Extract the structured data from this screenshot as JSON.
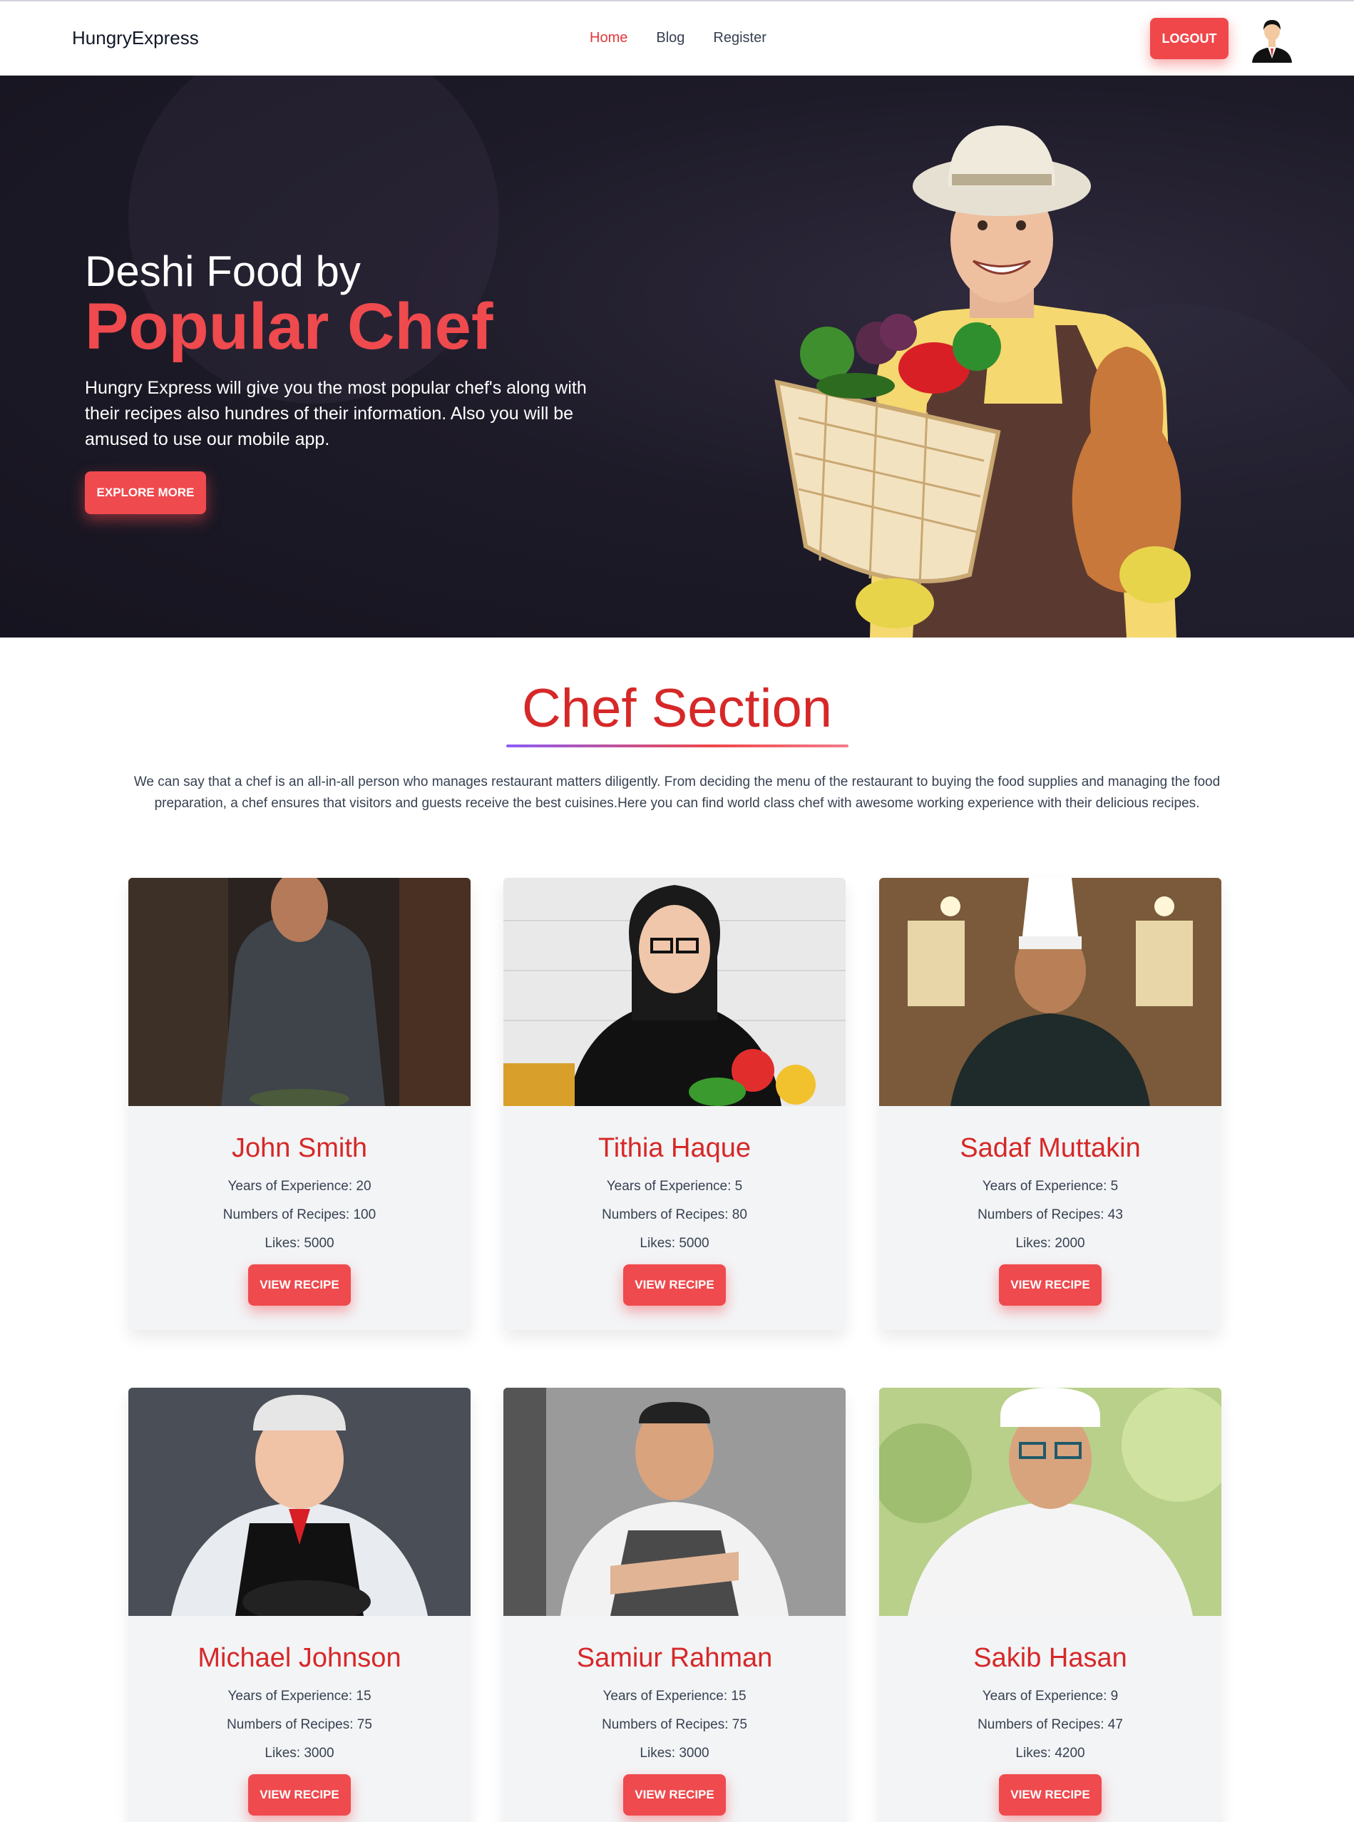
{
  "nav": {
    "brand": "HungryExpress",
    "links": [
      "Home",
      "Blog",
      "Register"
    ],
    "active_link": "Home",
    "logout_label": "LOGOUT"
  },
  "hero": {
    "title_line1": "Deshi Food by",
    "title_line2": "Popular Chef",
    "description": "Hungry Express will give you the most popular chef's along with their recipes also hundres of their information. Also you will be amused to use our mobile app.",
    "button_label": "EXPLORE MORE"
  },
  "chef_section": {
    "title": "Chef Section",
    "description": "We can say that a chef is an all-in-all person who manages restaurant matters diligently. From deciding the menu of the restaurant to buying the food supplies and managing the food preparation, a chef ensures that visitors and guests receive the best cuisines.Here you can find world class chef with awesome working experience with their delicious recipes."
  },
  "chefs": [
    {
      "name": "John Smith",
      "experience": "Years of Experience: 20",
      "recipes": "Numbers of Recipes: 100",
      "likes": "Likes: 5000",
      "button": "VIEW RECIPE"
    },
    {
      "name": "Tithia Haque",
      "experience": "Years of Experience: 5",
      "recipes": "Numbers of Recipes: 80",
      "likes": "Likes: 5000",
      "button": "VIEW RECIPE"
    },
    {
      "name": "Sadaf Muttakin",
      "experience": "Years of Experience: 5",
      "recipes": "Numbers of Recipes: 43",
      "likes": "Likes: 2000",
      "button": "VIEW RECIPE"
    },
    {
      "name": "Michael Johnson",
      "experience": "Years of Experience: 15",
      "recipes": "Numbers of Recipes: 75",
      "likes": "Likes: 3000",
      "button": "VIEW RECIPE"
    },
    {
      "name": "Samiur Rahman",
      "experience": "Years of Experience: 15",
      "recipes": "Numbers of Recipes: 75",
      "likes": "Likes: 3000",
      "button": "VIEW RECIPE"
    },
    {
      "name": "Sakib Hasan",
      "experience": "Years of Experience: 9",
      "recipes": "Numbers of Recipes: 47",
      "likes": "Likes: 4200",
      "button": "VIEW RECIPE"
    }
  ],
  "colors": {
    "accent": "#ef4a4e",
    "heading_red": "#d62828",
    "hero_bg": "#1e1b29",
    "card_bg": "#f3f4f6"
  }
}
